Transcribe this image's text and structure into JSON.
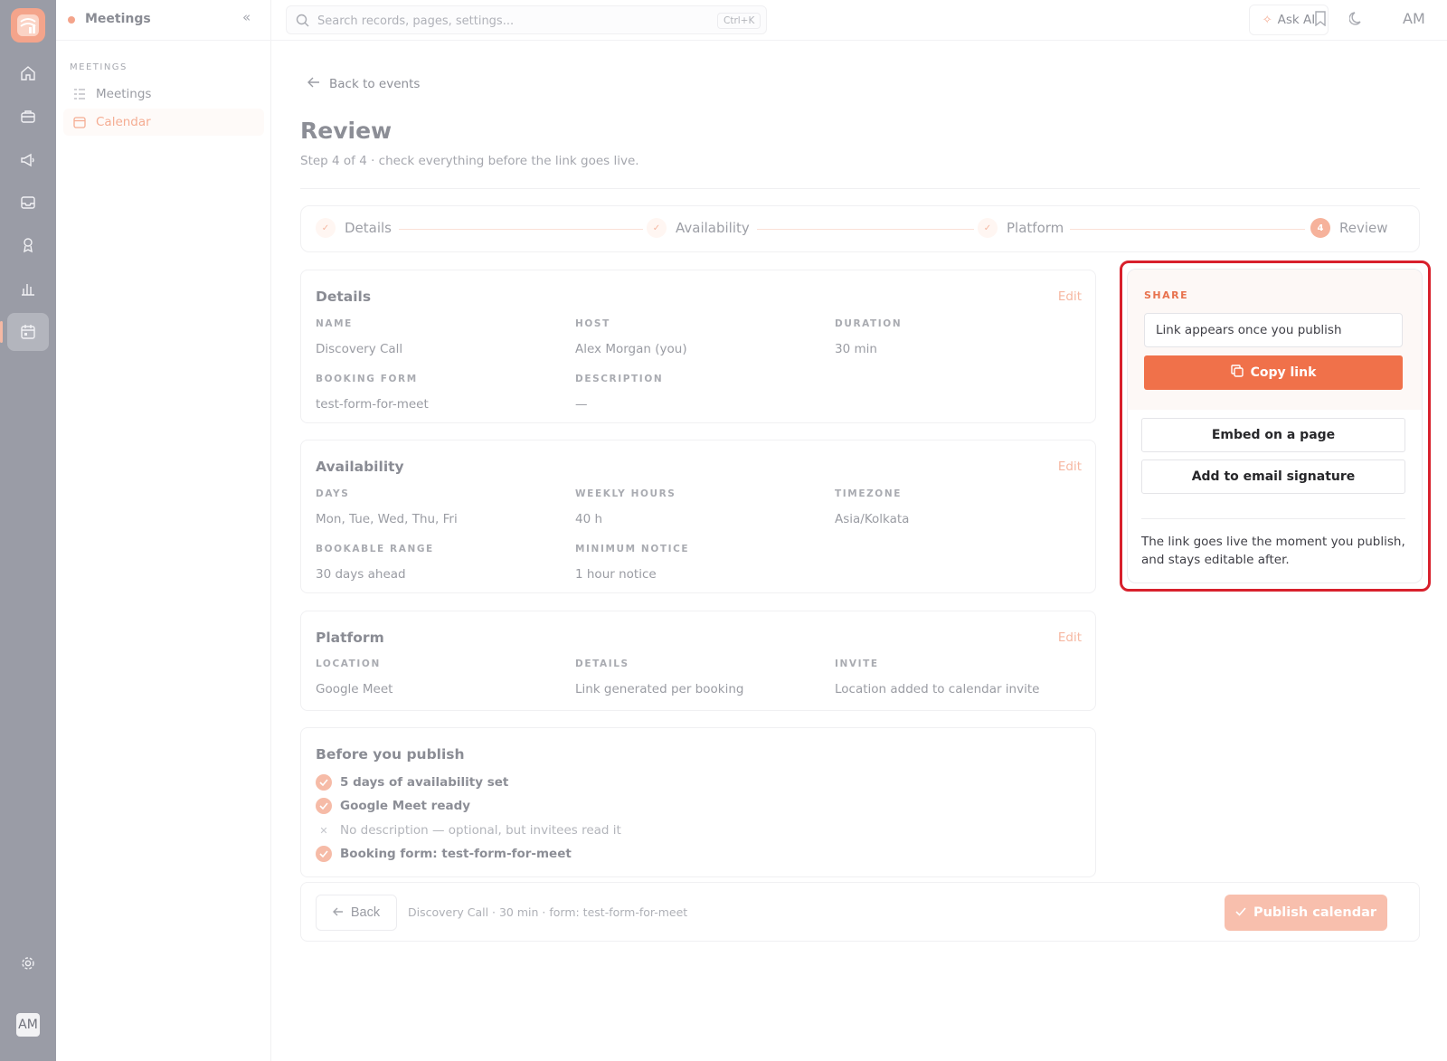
{
  "app": {
    "section_title": "Meetings",
    "user_initials": "AM"
  },
  "sidebar": {
    "section_label": "MEETINGS",
    "items": [
      {
        "label": "Meetings",
        "active": false
      },
      {
        "label": "Calendar",
        "active": true
      }
    ]
  },
  "search": {
    "placeholder": "Search records, pages, settings...",
    "shortcut": "Ctrl+K"
  },
  "topbar": {
    "ask_ai": "Ask AI"
  },
  "page": {
    "back_link": "Back to events",
    "title": "Review",
    "subtitle": "Step 4 of 4 · check everything before the link goes live."
  },
  "stepper": {
    "steps": [
      {
        "label": "Details",
        "state": "done"
      },
      {
        "label": "Availability",
        "state": "done"
      },
      {
        "label": "Platform",
        "state": "done"
      },
      {
        "label": "Review",
        "state": "current",
        "number": "4"
      }
    ]
  },
  "details": {
    "title": "Details",
    "edit": "Edit",
    "fields": [
      {
        "label": "NAME",
        "value": "Discovery Call"
      },
      {
        "label": "HOST",
        "value": "Alex Morgan (you)"
      },
      {
        "label": "DURATION",
        "value": "30 min"
      },
      {
        "label": "BOOKING FORM",
        "value": "test-form-for-meet"
      },
      {
        "label": "DESCRIPTION",
        "value": "—"
      }
    ]
  },
  "availability": {
    "title": "Availability",
    "edit": "Edit",
    "fields": [
      {
        "label": "DAYS",
        "value": "Mon, Tue, Wed, Thu, Fri"
      },
      {
        "label": "WEEKLY HOURS",
        "value": "40 h"
      },
      {
        "label": "TIMEZONE",
        "value": "Asia/Kolkata"
      },
      {
        "label": "BOOKABLE RANGE",
        "value": "30 days ahead"
      },
      {
        "label": "MINIMUM NOTICE",
        "value": "1 hour notice"
      }
    ]
  },
  "platform": {
    "title": "Platform",
    "edit": "Edit",
    "fields": [
      {
        "label": "LOCATION",
        "value": "Google Meet"
      },
      {
        "label": "DETAILS",
        "value": "Link generated per booking"
      },
      {
        "label": "INVITE",
        "value": "Location added to calendar invite"
      }
    ]
  },
  "checklist": {
    "title": "Before you publish",
    "items": [
      {
        "text": "5 days of availability set",
        "ok": true
      },
      {
        "text": "Google Meet ready",
        "ok": true
      },
      {
        "text": "No description — optional, but invitees read it",
        "ok": false
      },
      {
        "text": "Booking form: test-form-for-meet",
        "ok": true
      }
    ]
  },
  "footer": {
    "back": "Back",
    "summary": "Discovery Call · 30 min · form: test-form-for-meet",
    "publish": "Publish calendar"
  },
  "share": {
    "label": "SHARE",
    "link_placeholder": "Link appears once you publish",
    "copy": "Copy link",
    "embed": "Embed on a page",
    "email_signature": "Add to email signature",
    "note": "The link goes live the moment you publish, and stays editable after."
  },
  "colors": {
    "accent": "#f0714a",
    "accent_faded": "#f8bfad",
    "highlight_outline": "#d8202c"
  }
}
